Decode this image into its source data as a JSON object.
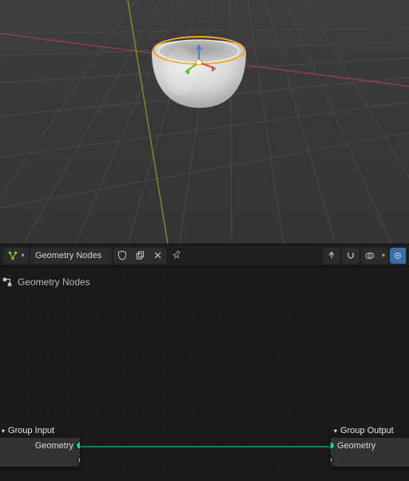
{
  "viewport": {
    "grid_color_minor": "#454545",
    "grid_color_major": "#4d4d4d",
    "axis_x_color": "#9a3a3a",
    "axis_y_color": "#6f9a2e",
    "object": "bowl",
    "object_fill_top": "#e9e9e9",
    "object_fill_bot": "#b9b9b9",
    "rim_outline": "#f5a623",
    "gizmo_arrow_colors": {
      "x": "#d24747",
      "y": "#6cbb3c",
      "z": "#4a7ecf"
    }
  },
  "header": {
    "editor_type_icon": "node-tree-icon",
    "node_name": "Geometry Nodes",
    "shield_icon": "fake-user-icon",
    "new_icon": "new-copy-icon",
    "close_icon": "unlink-icon",
    "pin_icon": "pin-icon",
    "right": {
      "parent_icon": "go-parent-icon",
      "snap_icon": "snap-icon",
      "overlay_icon": "overlay-icon",
      "view_icon": "view-icon"
    }
  },
  "node_editor": {
    "breadcrumb_icon": "node-tree-icon",
    "breadcrumb_label": "Geometry Nodes",
    "nodes": {
      "group_input": {
        "title": "Group Input",
        "socket_geometry": "Geometry"
      },
      "group_output": {
        "title": "Group Output",
        "socket_geometry": "Geometry"
      }
    }
  }
}
